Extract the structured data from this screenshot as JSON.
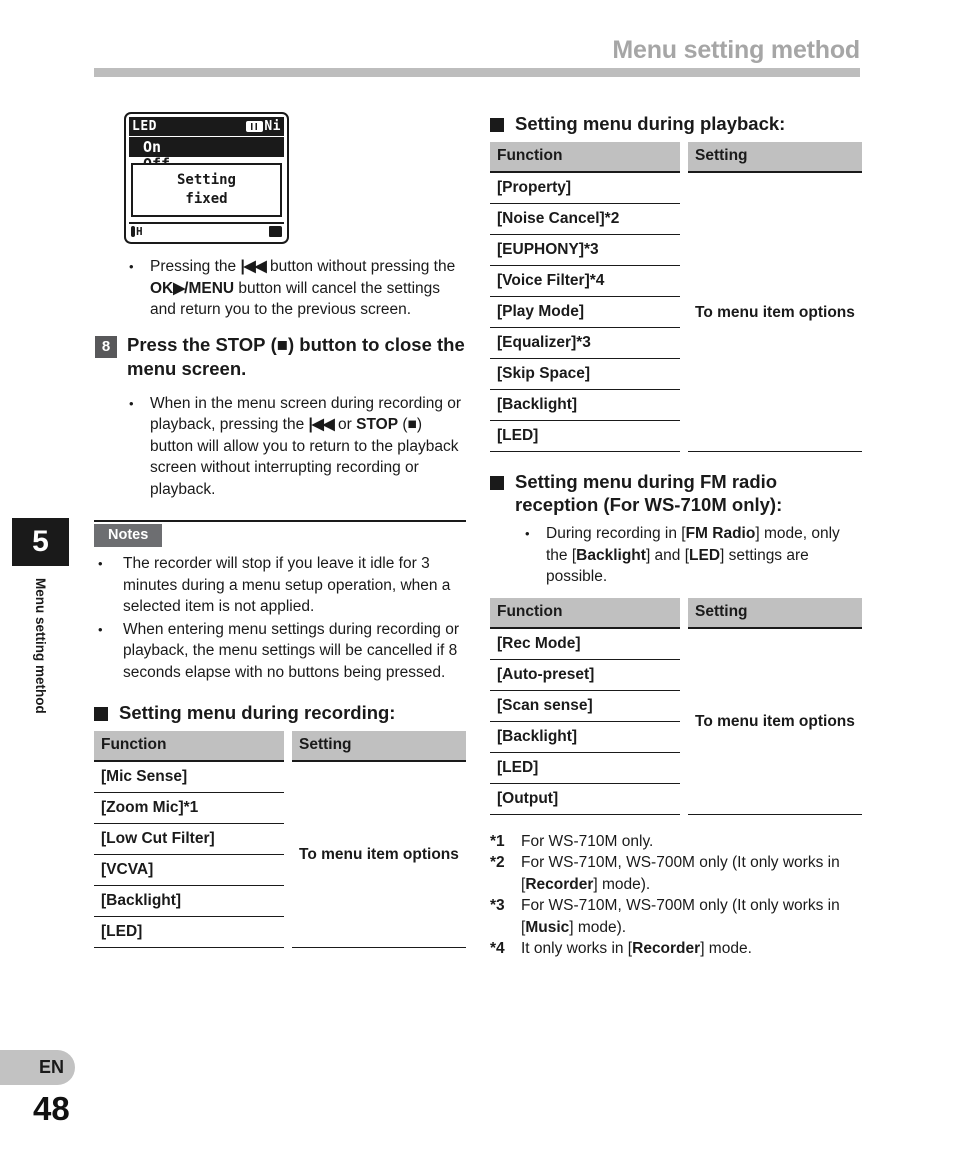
{
  "header": {
    "title": "Menu setting method"
  },
  "sidebar": {
    "chapter_number": "5",
    "chapter_label": "Menu setting method",
    "language": "EN",
    "page_number": "48"
  },
  "lcd": {
    "title": "LED",
    "battery_label": "Ni",
    "selected_item": "On",
    "next_item": "Off",
    "popup_line1": "Setting",
    "popup_line2": "fixed",
    "status_left": "H",
    "mic_icon": "mic-icon",
    "folder_icon": "folder-icon",
    "battery_icon": "battery-icon"
  },
  "left_column": {
    "intro_bullet": {
      "pre": "Pressing the ",
      "glyph1": "◀◀",
      "mid1": " button without pressing the ",
      "bold1": "OK",
      "glyph2": "▶",
      "bold2": "/MENU",
      "mid2": " button will cancel the settings and return you to the previous screen."
    },
    "step": {
      "number": "8",
      "pre": "Press the ",
      "bold1": "STOP",
      "mid": " (",
      "glyph": "■",
      "post": ") button to close the menu screen."
    },
    "step_bullet": {
      "pre": "When in the menu screen during recording or playback, pressing the ",
      "glyph1": "◀◀",
      "mid1": " or ",
      "bold1": "STOP",
      "mid2": " (",
      "glyph2": "■",
      "post": ") button will allow you to return to the playback screen without interrupting recording or playback."
    },
    "notes_label": "Notes",
    "notes": [
      "The recorder will stop if you leave it idle for 3 minutes during a menu setup operation, when a selected item is not applied.",
      "When entering menu settings during recording or playback, the menu settings will be cancelled if 8 seconds elapse with no buttons being pressed."
    ],
    "recording_section": {
      "heading": "Setting menu during recording:",
      "table": {
        "columns": [
          "Function",
          "Setting"
        ],
        "setting_value": "To menu item options",
        "functions": [
          "[Mic Sense]",
          "[Zoom Mic]*1",
          "[Low Cut Filter]",
          "[VCVA]",
          "[Backlight]",
          "[LED]"
        ]
      }
    }
  },
  "right_column": {
    "playback_section": {
      "heading": "Setting menu during playback:",
      "table": {
        "columns": [
          "Function",
          "Setting"
        ],
        "setting_value": "To menu item options",
        "functions": [
          "[Property]",
          "[Noise Cancel]*2",
          "[EUPHONY]*3",
          "[Voice Filter]*4",
          "[Play Mode]",
          "[Equalizer]*3",
          "[Skip Space]",
          "[Backlight]",
          "[LED]"
        ]
      }
    },
    "fm_section": {
      "heading_line1": "Setting menu during FM radio",
      "heading_line2": "reception (For WS-710M only):",
      "bullet": {
        "pre": "During recording in [",
        "bold1": "FM Radio",
        "mid1": "] mode, only the [",
        "bold2": "Backlight",
        "mid2": "] and [",
        "bold3": "LED",
        "post": "] settings are possible."
      },
      "table": {
        "columns": [
          "Function",
          "Setting"
        ],
        "setting_value": "To menu item options",
        "functions": [
          "[Rec Mode]",
          "[Auto-preset]",
          "[Scan sense]",
          "[Backlight]",
          "[LED]",
          "[Output]"
        ]
      }
    },
    "footnotes": [
      {
        "mark": "*1",
        "pre": "For WS-710M only.",
        "bold": "",
        "post": ""
      },
      {
        "mark": "*2",
        "pre": "For WS-710M, WS-700M only (It only works in [",
        "bold": "Recorder",
        "post": "] mode)."
      },
      {
        "mark": "*3",
        "pre": "For WS-710M, WS-700M only (It only works in [",
        "bold": "Music",
        "post": "] mode)."
      },
      {
        "mark": "*4",
        "pre": "It only works in [",
        "bold": "Recorder",
        "post": "] mode."
      }
    ]
  },
  "colors": {
    "header_gray": "#a6a6a6",
    "rule_gray": "#bdbdbd",
    "table_header_gray": "#c0c0c0",
    "notes_gray": "#6d6e71",
    "step_gray": "#58585a",
    "lang_tab_gray": "#c2c2c2",
    "ink": "#1a1a1a"
  }
}
